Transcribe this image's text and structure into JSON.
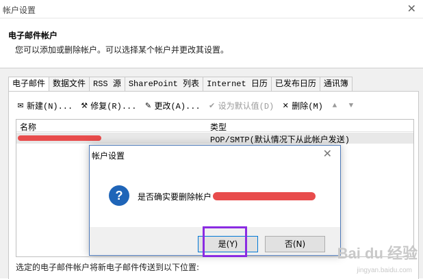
{
  "window": {
    "title": "帐户设置",
    "close": "✕"
  },
  "header": {
    "heading": "电子邮件帐户",
    "description": "您可以添加或删除帐户。可以选择某个帐户并更改其设置。"
  },
  "tabs": [
    {
      "label": "电子邮件",
      "active": true
    },
    {
      "label": "数据文件"
    },
    {
      "label": "RSS 源"
    },
    {
      "label": "SharePoint 列表"
    },
    {
      "label": "Internet 日历"
    },
    {
      "label": "已发布日历"
    },
    {
      "label": "通讯簿"
    }
  ],
  "toolbar": {
    "new_label": "新建(N)...",
    "repair_label": "修复(R)...",
    "change_label": "更改(A)...",
    "default_label": "设为默认值(D)",
    "delete_label": "删除(M)",
    "up": "▲",
    "down": "▼"
  },
  "list": {
    "col_name": "名称",
    "col_type": "类型",
    "rows": [
      {
        "type": "POP/SMTP(默认情况下从此帐户发送)"
      }
    ]
  },
  "footer": {
    "text": "选定的电子邮件帐户将新电子邮件传送到以下位置:"
  },
  "dialog": {
    "title": "帐户设置",
    "close": "✕",
    "icon": "?",
    "message": "是否确实要删除帐户",
    "yes_label": "是(Y)",
    "no_label": "否(N)"
  },
  "watermark": {
    "logo": "Bai du 经验",
    "sub": "jingyan.baidu.com"
  },
  "colors": {
    "accent": "#0078d7",
    "highlight": "#8a2be2",
    "redaction": "#e84c4c"
  }
}
